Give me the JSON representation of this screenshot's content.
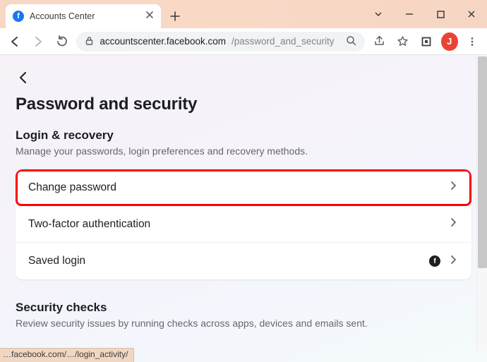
{
  "browser": {
    "tab_title": "Accounts Center",
    "url_domain": "accountscenter.facebook.com",
    "url_path": "/password_and_security",
    "avatar_letter": "J",
    "favicon_letter": "f",
    "status_hint": "…facebook.com/…/login_activity/"
  },
  "page": {
    "title": "Password and security",
    "section1": {
      "heading": "Login & recovery",
      "sub": "Manage your passwords, login preferences and recovery methods.",
      "items": [
        {
          "label": "Change password"
        },
        {
          "label": "Two-factor authentication"
        },
        {
          "label": "Saved login"
        }
      ]
    },
    "section2": {
      "heading": "Security checks",
      "sub": "Review security issues by running checks across apps, devices and emails sent."
    }
  }
}
